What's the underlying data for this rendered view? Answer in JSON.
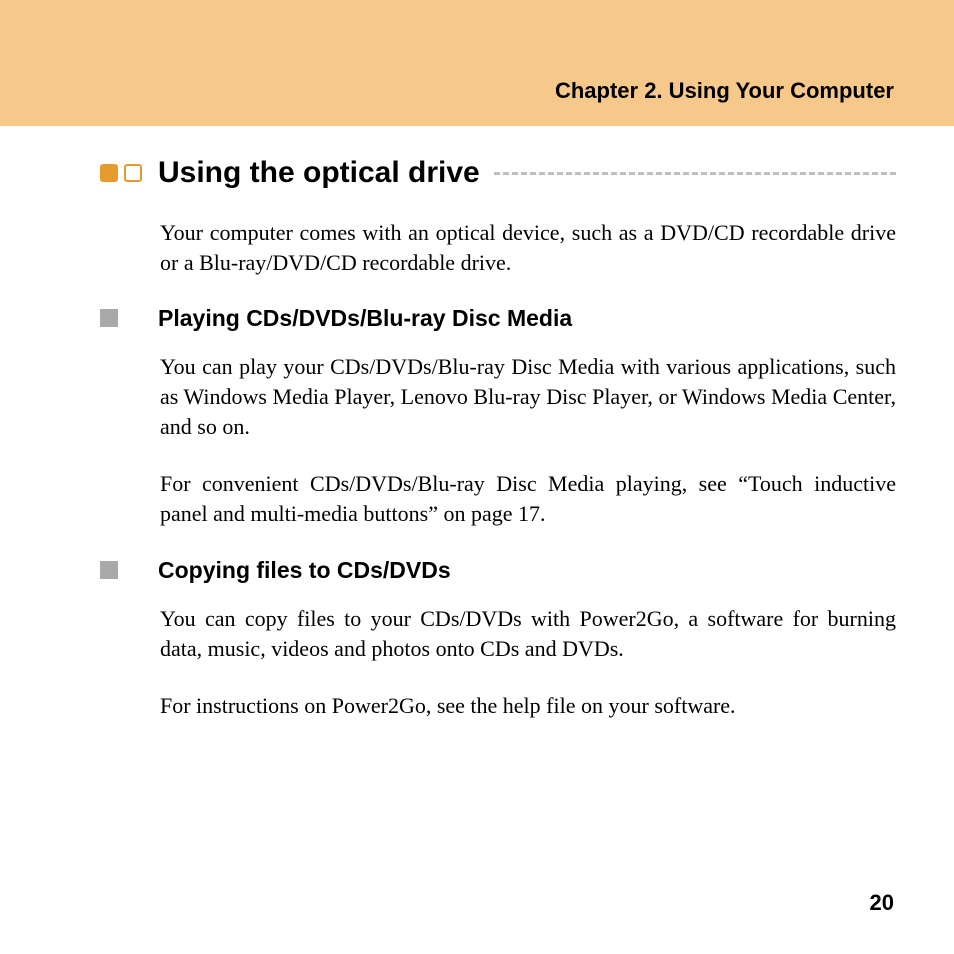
{
  "header": {
    "chapter": "Chapter 2. Using Your Computer"
  },
  "section": {
    "title": "Using the optical drive",
    "intro": "Your computer comes with an optical device, such as a DVD/CD recordable drive or a Blu-ray/DVD/CD recordable drive."
  },
  "subsections": [
    {
      "title": "Playing CDs/DVDs/Blu-ray Disc Media",
      "paragraphs": [
        "You can play your CDs/DVDs/Blu-ray Disc Media with various applications, such as Windows Media Player, Lenovo Blu-ray Disc Player, or Windows Media Center, and so on.",
        "For convenient CDs/DVDs/Blu-ray Disc Media playing, see “Touch inductive panel and multi-media buttons” on page 17."
      ]
    },
    {
      "title": "Copying files to CDs/DVDs",
      "paragraphs": [
        "You can copy files to your CDs/DVDs with Power2Go, a software for burning data, music, videos and photos onto CDs and DVDs.",
        "For instructions on Power2Go, see the help file on your software."
      ]
    }
  ],
  "page_number": "20"
}
